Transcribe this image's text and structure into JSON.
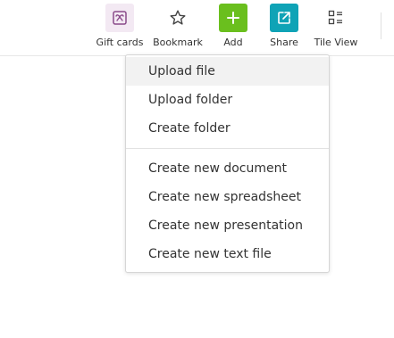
{
  "toolbar": {
    "items": [
      {
        "label": "Gift cards",
        "icon": "gift-card-icon"
      },
      {
        "label": "Bookmark",
        "icon": "star-icon"
      },
      {
        "label": "Add",
        "icon": "plus-icon"
      },
      {
        "label": "Share",
        "icon": "share-icon"
      },
      {
        "label": "Tile View",
        "icon": "tile-view-icon"
      }
    ]
  },
  "menu": {
    "group1": [
      "Upload file",
      "Upload folder",
      "Create folder"
    ],
    "group2": [
      "Create new document",
      "Create new spreadsheet",
      "Create new presentation",
      "Create new text file"
    ],
    "highlighted": "Upload file"
  },
  "colors": {
    "gift_bg": "#f3e9f3",
    "gift_icon": "#8a4a8a",
    "add_bg": "#6abf1e",
    "share_bg": "#0fa3b6",
    "menu_hover": "#f2f2f2"
  }
}
